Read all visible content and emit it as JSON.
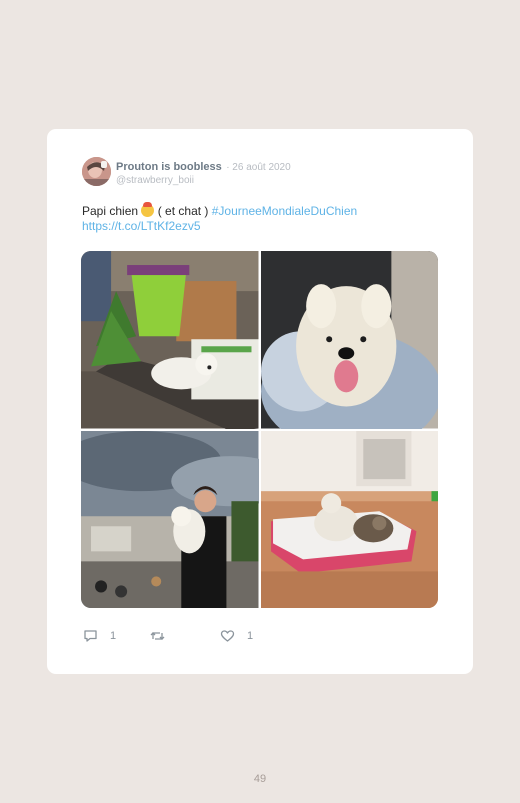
{
  "tweet": {
    "author_name": "Prouton is boobless",
    "date": "· 26 août 2020",
    "handle": "@strawberry_boii",
    "text_before": "Papi chien",
    "text_after": " ( et chat ) ",
    "hashtag": "#JourneeMondialeDuChien",
    "url": "https://t.co/LTtKf2ezv5",
    "emoji": "party-face-emoji",
    "photos": [
      "dog-with-plant-photo",
      "dog-on-cushion-photo",
      "person-holding-dog-photo",
      "dog-and-cat-on-bed-photo"
    ],
    "reply_count": "1",
    "retweet_count": "",
    "like_count": "1"
  },
  "page": {
    "number": "49"
  },
  "colors": {
    "background": "#ece6e2",
    "card": "#ffffff",
    "link": "#5fb3e6",
    "name": "#6d7a86",
    "meta": "#b8bcc2"
  },
  "icons": [
    "reply-icon",
    "retweet-icon",
    "like-icon"
  ]
}
